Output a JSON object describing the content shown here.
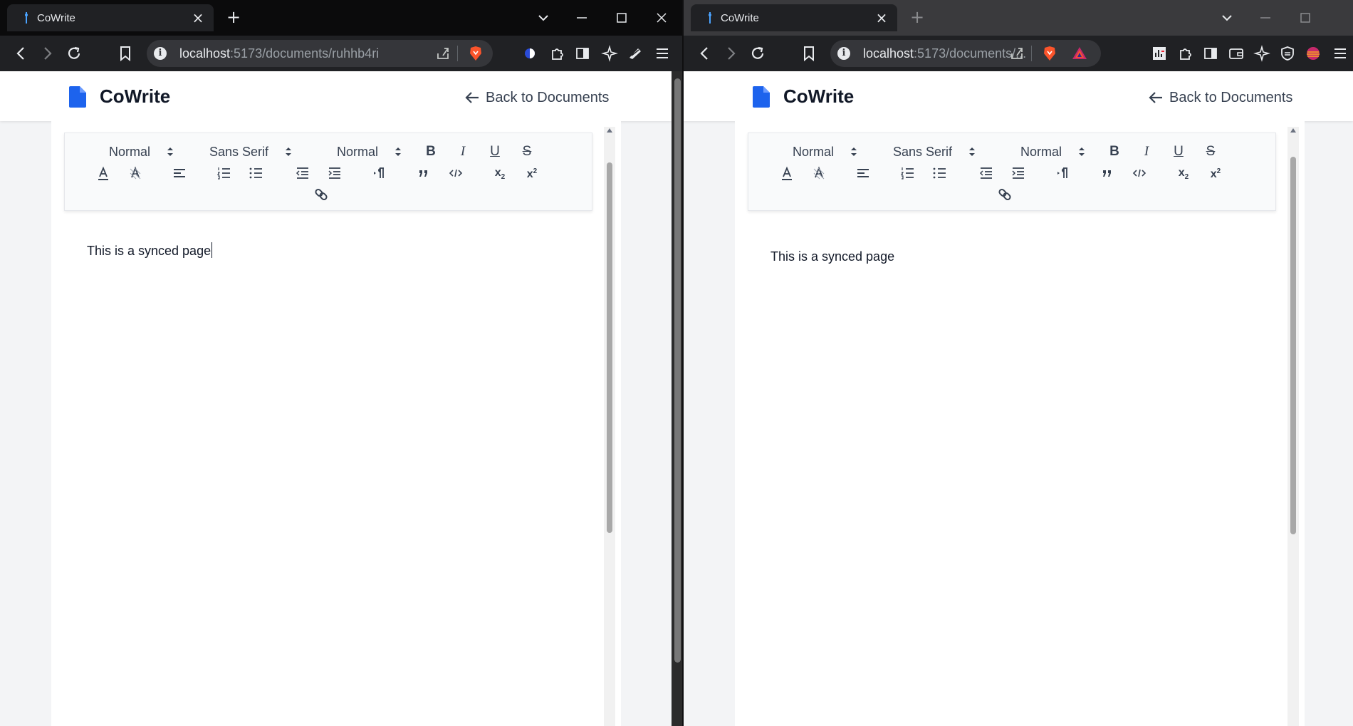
{
  "left": {
    "tab": {
      "title": "CoWrite",
      "close": "×"
    },
    "new_tab": "+",
    "url": {
      "host": "localhost",
      "rest": ":5173/documents/ruhhb4ri"
    },
    "app": {
      "brand": "CoWrite",
      "back": "Back to Documents",
      "toolbar": {
        "header_picker": "Normal",
        "font_picker": "Sans Serif",
        "size_picker": "Normal"
      },
      "content": "This is a synced page"
    }
  },
  "right": {
    "tab": {
      "title": "CoWrite",
      "close": "×"
    },
    "new_tab": "+",
    "url": {
      "host": "localhost",
      "rest": ":5173/documents/..."
    },
    "app": {
      "brand": "CoWrite",
      "back": "Back to Documents",
      "toolbar": {
        "header_picker": "Normal",
        "font_picker": "Sans Serif",
        "size_picker": "Normal"
      },
      "content": "This is a synced page"
    }
  },
  "colors": {
    "brand_blue": "#1d63ed",
    "brave_orange": "#fb542b",
    "browser_dark": "#202124"
  },
  "icons": [
    "tab-favicon-icon",
    "close-icon",
    "plus-icon",
    "chevron-down-icon",
    "minimize-icon",
    "maximize-icon",
    "window-close-icon",
    "back-arrow-icon",
    "forward-arrow-icon",
    "reload-icon",
    "bookmark-icon",
    "info-icon",
    "share-icon",
    "brave-shield-icon",
    "extensions-icon",
    "sidebar-icon",
    "wallet-icon",
    "leo-icon",
    "menu-icon",
    "document-icon",
    "arrow-left-icon",
    "text-color-icon",
    "background-color-icon",
    "align-icon",
    "ordered-list-icon",
    "bullet-list-icon",
    "outdent-icon",
    "indent-icon",
    "text-direction-icon",
    "blockquote-icon",
    "code-block-icon",
    "subscript-icon",
    "superscript-icon",
    "link-icon"
  ]
}
